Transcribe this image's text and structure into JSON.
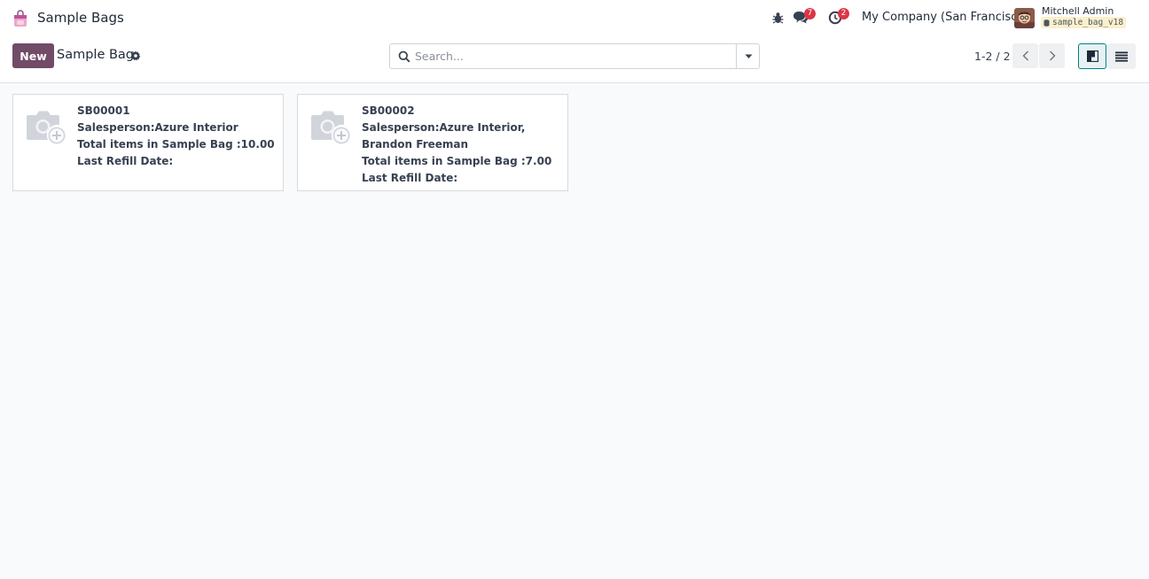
{
  "navbar": {
    "app_name": "Sample Bags",
    "messages_count": "7",
    "activities_count": "2",
    "company": "My Company (San Francisco)",
    "user_name": "Mitchell Admin",
    "database": "sample_bag_v18"
  },
  "control_panel": {
    "new_label": "New",
    "title": "Sample Bag",
    "search_placeholder": "Search...",
    "pager": "1-2 / 2"
  },
  "cards": [
    {
      "ref": "SB00001",
      "salesperson": "Salesperson:Azure Interior",
      "total_items": "Total items in Sample Bag :10.00",
      "last_refill": "Last Refill Date:"
    },
    {
      "ref": "SB00002",
      "salesperson": "Salesperson:Azure Interior, Brandon Freeman",
      "total_items": "Total items in Sample Bag :7.00",
      "last_refill": "Last Refill Date:"
    }
  ],
  "colors": {
    "brand": "#714b67",
    "badge": "#dc3545",
    "active_view": "#017e84"
  },
  "icons": {
    "app": "sample-bag-icon",
    "debug": "bug-icon",
    "messages": "chat-icon",
    "activities": "clock-icon",
    "settings": "gear-icon",
    "search": "search-icon",
    "filter_toggle": "caret-down-icon",
    "prev": "chevron-left-icon",
    "next": "chevron-right-icon",
    "kanban": "kanban-view-icon",
    "list": "list-view-icon",
    "placeholder": "camera-plus-icon"
  }
}
